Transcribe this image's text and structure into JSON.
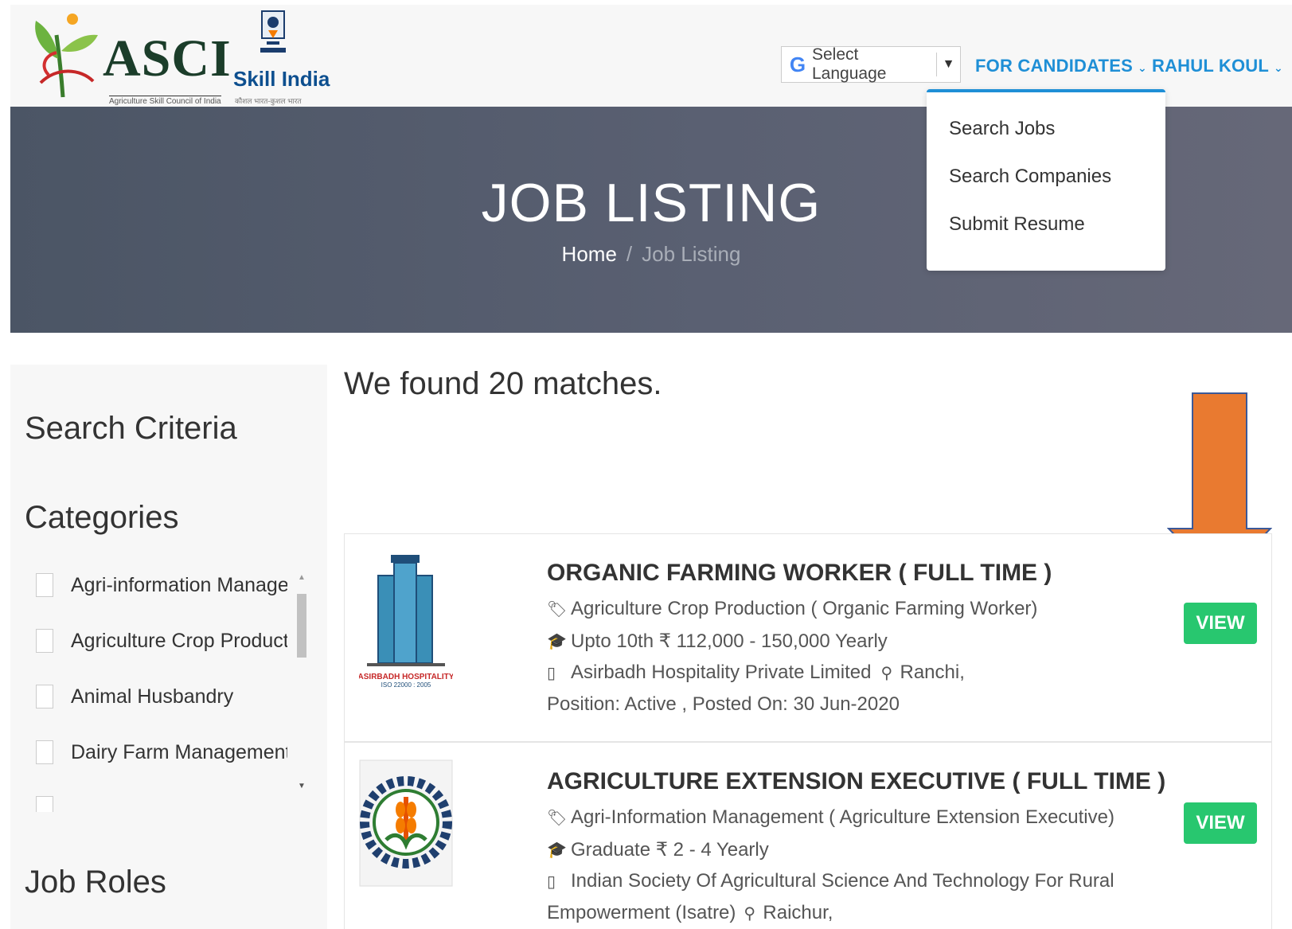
{
  "header": {
    "asci": {
      "name": "ASCI",
      "tagline": "Agriculture Skill Council of India"
    },
    "skill_india": {
      "name": "Skill India",
      "tagline": "कौशल भारत-कुशल भारत"
    },
    "language": {
      "label": "Select Language",
      "g": "G",
      "arrow": "▼"
    },
    "nav": {
      "candidates": "FOR CANDIDATES",
      "user": "RAHUL KOUL"
    }
  },
  "dropdown": {
    "items": [
      "Search Jobs",
      "Search Companies",
      "Submit Resume"
    ]
  },
  "banner": {
    "title": "JOB LISTING",
    "breadcrumb": {
      "home": "Home",
      "sep": "/",
      "current": "Job Listing"
    }
  },
  "sidebar": {
    "search_criteria": "Search Criteria",
    "categories_heading": "Categories",
    "categories": [
      "Agri-information Management",
      "Agriculture Crop Production",
      "Animal Husbandry",
      "Dairy Farm Management"
    ],
    "job_roles_heading": "Job Roles"
  },
  "results": {
    "summary": "We found 20 matches.",
    "jobs": [
      {
        "title": "ORGANIC FARMING WORKER ( FULL TIME )",
        "category": "Agriculture Crop Production ( Organic Farming Worker)",
        "salary": "Upto 10th ₹ 112,000 - 150,000 Yearly",
        "company": "Asirbadh Hospitality Private Limited",
        "location": "Ranchi,",
        "status": "Position: Active , Posted On: 30 Jun-2020",
        "logo_text": "ASIRBADH HOSPITALITY",
        "logo_sub": "ISO 22000 : 2005",
        "view": "VIEW"
      },
      {
        "title": "AGRICULTURE EXTENSION EXECUTIVE ( FULL TIME )",
        "category": "Agri-Information Management ( Agriculture Extension Executive)",
        "salary": "Graduate ₹ 2 - 4 Yearly",
        "company": "Indian Society Of Agricultural Science And Technology For Rural",
        "company_cont": "Empowerment (Isatre)",
        "location": "Raichur,",
        "view": "VIEW"
      }
    ]
  },
  "colors": {
    "accent": "#1f8fd6",
    "view_button": "#28c76f",
    "arrow": "#e97a30",
    "banner": "#555d6e"
  }
}
